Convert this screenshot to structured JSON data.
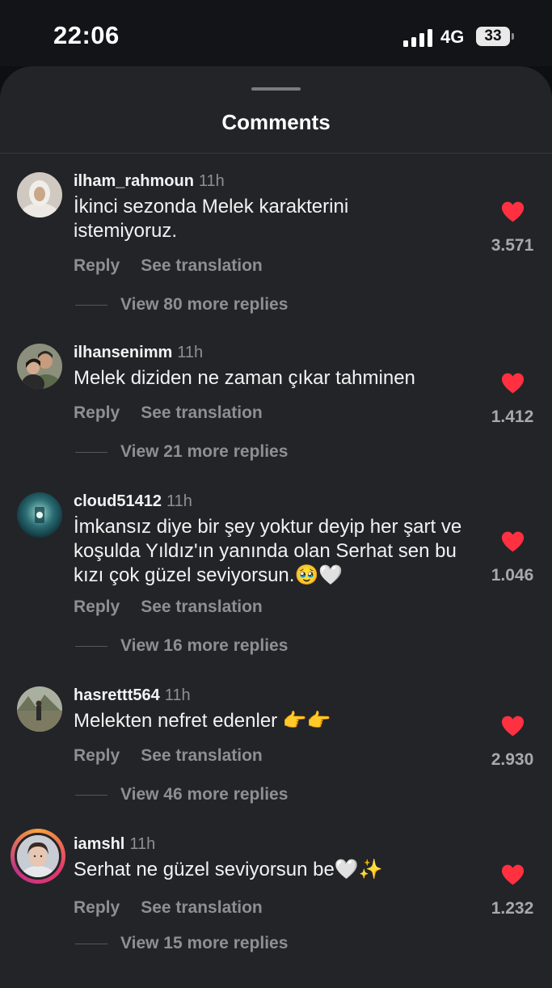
{
  "status": {
    "time": "22:06",
    "network": "4G",
    "battery": "33"
  },
  "sheet": {
    "title": "Comments"
  },
  "comments": [
    {
      "username": "ilham_rahmoun",
      "time": "11h",
      "text": "İkinci sezonda Melek karakterini istemiyoruz.",
      "reply": "Reply",
      "translate": "See translation",
      "view_replies": "View 80 more replies",
      "likes": "3.571",
      "avatar": "woman-hijab-avatar"
    },
    {
      "username": "ilhansenimm",
      "time": "11h",
      "text": "Melek diziden ne zaman çıkar tahminen",
      "reply": "Reply",
      "translate": "See translation",
      "view_replies": "View 21 more replies",
      "likes": "1.412",
      "avatar": "couple-avatar"
    },
    {
      "username": "cloud51412",
      "time": "11h",
      "text": "İmkansız diye bir şey yoktur deyip her şart ve koşulda Yıldız'ın yanında olan Serhat sen bu kızı çok güzel seviyorsun.🥹🤍",
      "reply": "Reply",
      "translate": "See translation",
      "view_replies": "View 16 more replies",
      "likes": "1.046",
      "avatar": "teal-lantern-avatar"
    },
    {
      "username": "hasrettt564",
      "time": "11h",
      "text": "Melekten nefret edenler 👉👉",
      "reply": "Reply",
      "translate": "See translation",
      "view_replies": "View 46 more replies",
      "likes": "2.930",
      "avatar": "outdoor-photo-avatar"
    },
    {
      "username": "iamshl",
      "time": "11h",
      "text": "Serhat ne güzel seviyorsun be🤍✨",
      "reply": "Reply",
      "translate": "See translation",
      "view_replies": "View 15 more replies",
      "likes": "1.232",
      "avatar": "selfie-avatar-with-story-ring"
    }
  ],
  "colors": {
    "sheet_bg": "#232428",
    "heart": "#ff3040",
    "muted_text": "#8e8f94"
  }
}
